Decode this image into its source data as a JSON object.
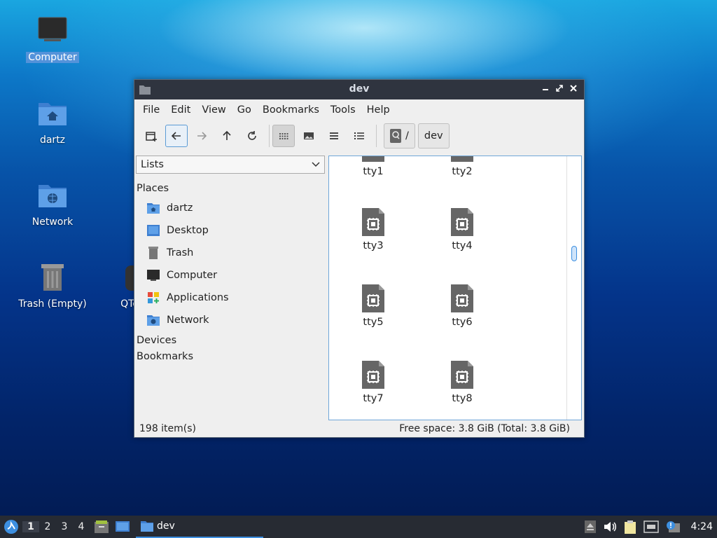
{
  "desktop": {
    "icons": [
      {
        "label": "Computer"
      },
      {
        "label": "dartz"
      },
      {
        "label": "Network"
      },
      {
        "label": "Trash (Empty)"
      },
      {
        "label": "QTe"
      }
    ]
  },
  "window": {
    "title": "dev",
    "menu": [
      "File",
      "Edit",
      "View",
      "Go",
      "Bookmarks",
      "Tools",
      "Help"
    ],
    "breadcrumb": [
      "/",
      "dev"
    ],
    "sidebar": {
      "dropdown_value": "Lists",
      "places_header": "Places",
      "places": [
        "dartz",
        "Desktop",
        "Trash",
        "Computer",
        "Applications",
        "Network"
      ],
      "devices_header": "Devices",
      "bookmarks_header": "Bookmarks"
    },
    "files": [
      "tty1",
      "tty2",
      "tty3",
      "tty4",
      "tty5",
      "tty6",
      "tty7",
      "tty8"
    ],
    "status": {
      "items": "198 item(s)",
      "free_space": "Free space: 3.8 GiB (Total: 3.8 GiB)"
    }
  },
  "taskbar": {
    "workspaces": [
      "1",
      "2",
      "3",
      "4"
    ],
    "active_workspace": "1",
    "task_label": "dev",
    "clock": "4:24"
  }
}
